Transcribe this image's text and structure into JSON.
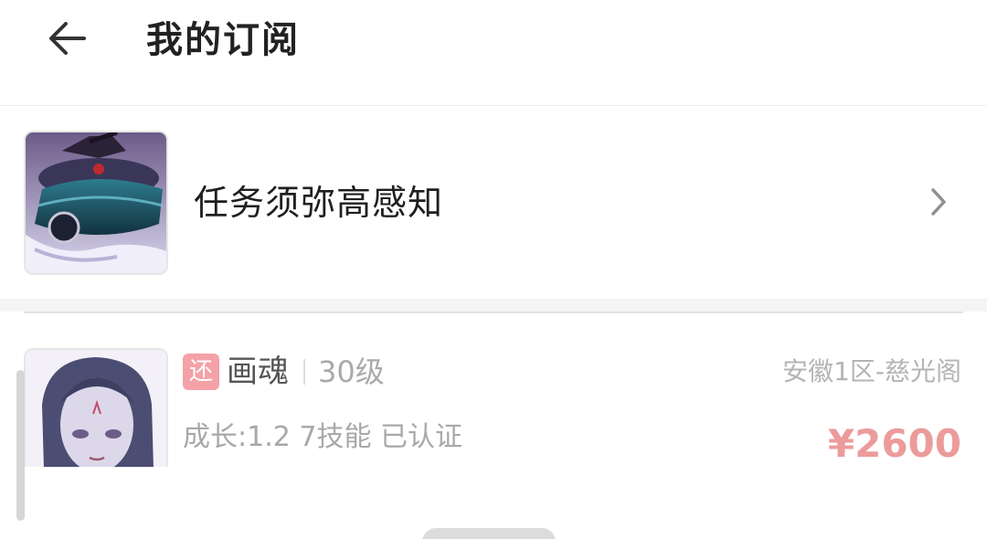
{
  "header": {
    "title": "我的订阅"
  },
  "subscription": {
    "name": "任务须弥高感知"
  },
  "item": {
    "badge": "还",
    "name": "画魂",
    "level": "30级",
    "server": "安徽1区-慈光阁",
    "desc": "成长:1.2 7技能 已认证",
    "price": "¥2600"
  },
  "colors": {
    "badge_bg": "#f4a1a7",
    "price": "#ec9b9b"
  },
  "icons": {
    "back": "arrow-left-icon",
    "chevron": "chevron-right-icon"
  }
}
